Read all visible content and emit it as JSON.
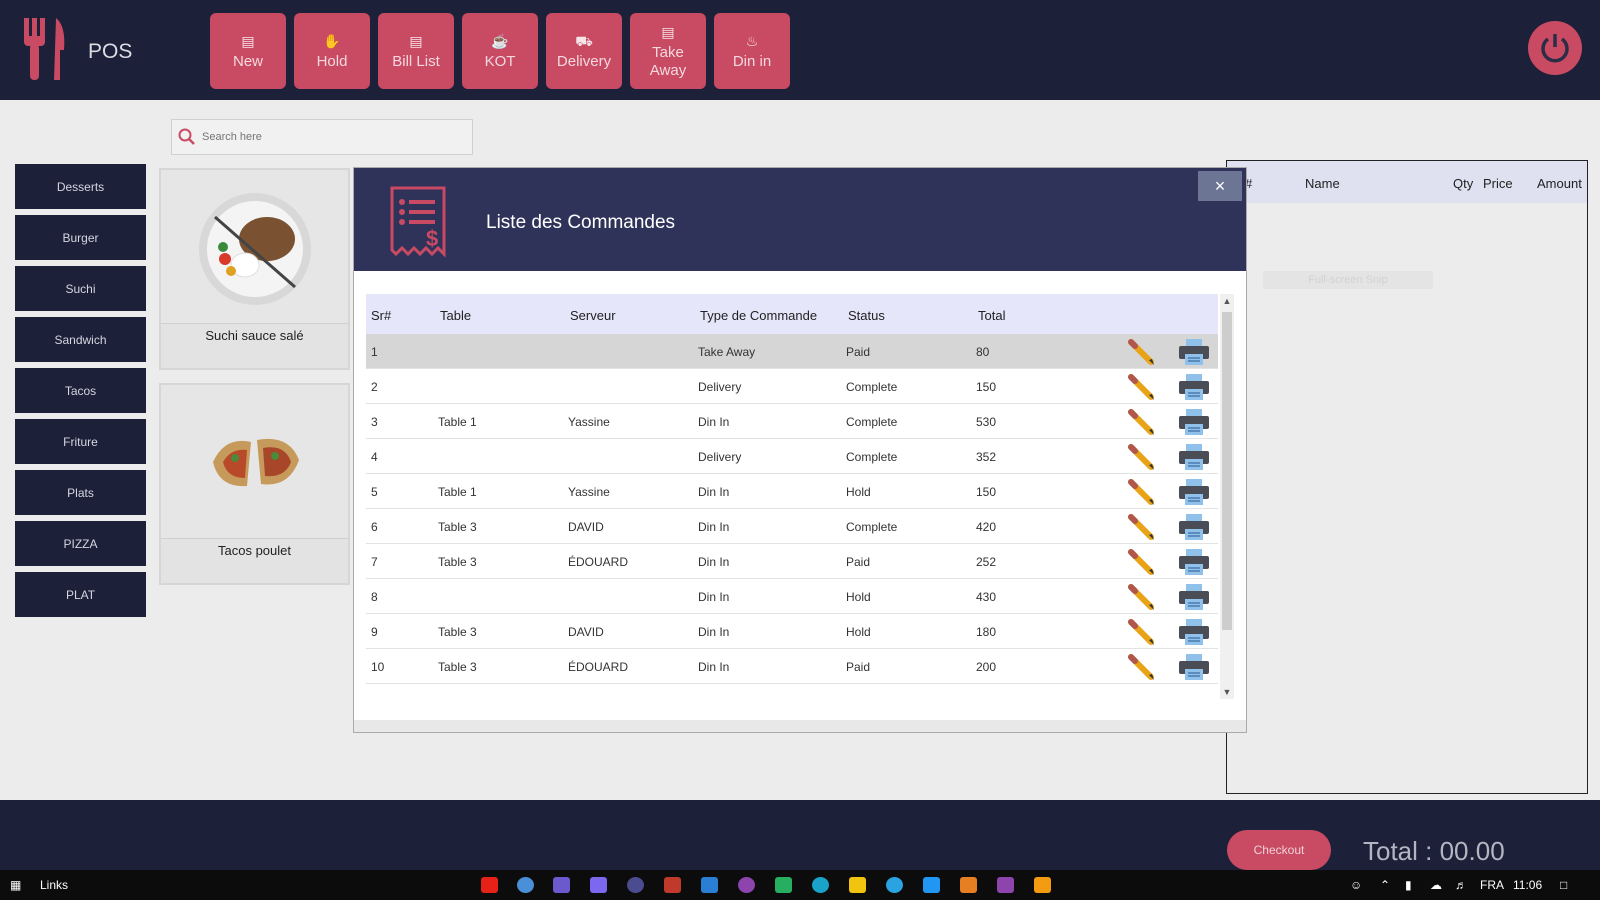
{
  "app": {
    "title": "POS"
  },
  "toolbar": [
    {
      "id": "new",
      "label": "New"
    },
    {
      "id": "hold",
      "label": "Hold"
    },
    {
      "id": "bill-list",
      "label": "Bill List"
    },
    {
      "id": "kot",
      "label": "KOT"
    },
    {
      "id": "delivery",
      "label": "Delivery"
    },
    {
      "id": "take-away",
      "label": "Take\nAway"
    },
    {
      "id": "din-in",
      "label": "Din in"
    }
  ],
  "search": {
    "placeholder": "Search here"
  },
  "categories": [
    "Desserts",
    "Burger",
    "Suchi",
    "Sandwich",
    "Tacos",
    "Friture",
    "Plats",
    "PIZZA",
    "PLAT"
  ],
  "products": [
    {
      "name": "Suchi sauce salé"
    },
    {
      "name": "Tacos poulet"
    }
  ],
  "order_panel": {
    "columns": [
      "#",
      "Name",
      "Qty",
      "Price",
      "Amount"
    ],
    "snip_text": "Full-screen Snip"
  },
  "checkout": {
    "label": "Checkout"
  },
  "total": {
    "text": "Total : 00.00"
  },
  "modal": {
    "title": "Liste des Commandes",
    "close": "×",
    "columns": [
      "Sr#",
      "Table",
      "Serveur",
      "Type de Commande",
      "Status",
      "Total"
    ],
    "rows": [
      {
        "sr": "1",
        "table": "",
        "serveur": "",
        "type": "Take Away",
        "status": "Paid",
        "total": "80"
      },
      {
        "sr": "2",
        "table": "",
        "serveur": "",
        "type": "Delivery",
        "status": "Complete",
        "total": "150"
      },
      {
        "sr": "3",
        "table": "Table 1",
        "serveur": "Yassine",
        "type": "Din In",
        "status": "Complete",
        "total": "530"
      },
      {
        "sr": "4",
        "table": "",
        "serveur": "",
        "type": "Delivery",
        "status": "Complete",
        "total": "352"
      },
      {
        "sr": "5",
        "table": "Table 1",
        "serveur": "Yassine",
        "type": "Din In",
        "status": "Hold",
        "total": "150"
      },
      {
        "sr": "6",
        "table": "Table 3",
        "serveur": "DAVID",
        "type": "Din In",
        "status": "Complete",
        "total": "420"
      },
      {
        "sr": "7",
        "table": "Table 3",
        "serveur": "ÉDOUARD",
        "type": "Din In",
        "status": "Paid",
        "total": "252"
      },
      {
        "sr": "8",
        "table": "",
        "serveur": "",
        "type": "Din In",
        "status": "Hold",
        "total": "430"
      },
      {
        "sr": "9",
        "table": "Table 3",
        "serveur": "DAVID",
        "type": "Din In",
        "status": "Hold",
        "total": "180"
      },
      {
        "sr": "10",
        "table": "Table 3",
        "serveur": "ÉDOUARD",
        "type": "Din In",
        "status": "Paid",
        "total": "200"
      }
    ]
  },
  "taskbar": {
    "start_label": "Links",
    "language": "FRA",
    "time": "11:06"
  },
  "colors": {
    "navy": "#1c2038",
    "accent": "#c94a63",
    "modal_header": "#2f335a"
  }
}
